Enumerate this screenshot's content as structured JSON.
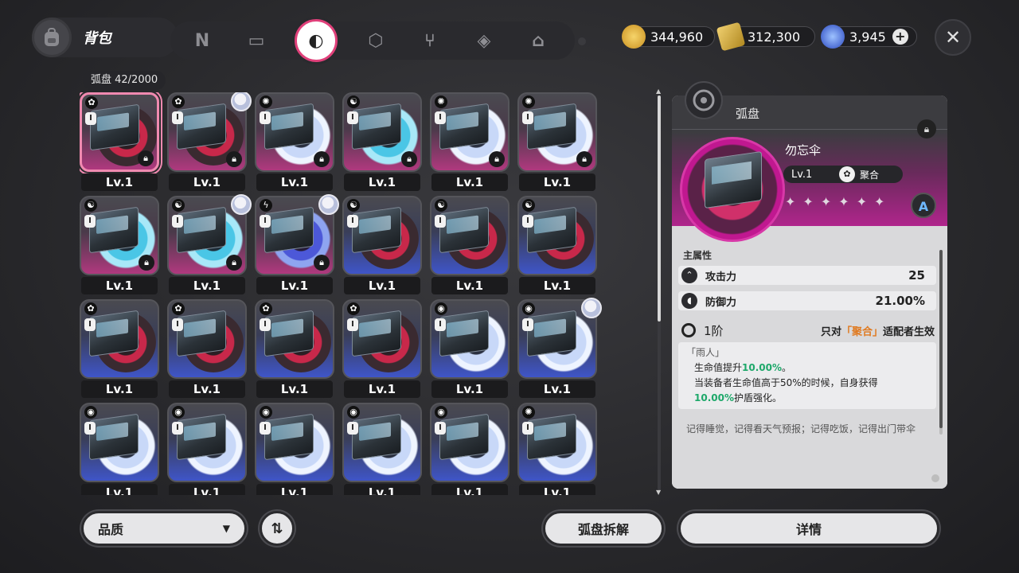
{
  "header": {
    "title": "背包",
    "categories": [
      {
        "name": "category-n-icon",
        "glyph": "N"
      },
      {
        "name": "category-console-icon",
        "glyph": "▭"
      },
      {
        "name": "category-disc-icon",
        "glyph": "◐",
        "active": true
      },
      {
        "name": "category-cube-icon",
        "glyph": "⬡"
      },
      {
        "name": "category-food-icon",
        "glyph": "⑂"
      },
      {
        "name": "category-gem-icon",
        "glyph": "◈"
      },
      {
        "name": "category-home-icon",
        "glyph": "⌂"
      }
    ],
    "currencies": [
      {
        "name": "gold-coin",
        "value": "344,960",
        "color": "#e8b83a"
      },
      {
        "name": "ticket",
        "value": "312,300",
        "color": "#d9b84a"
      },
      {
        "name": "crystal",
        "value": "3,945",
        "color": "#3a6ae8"
      }
    ],
    "add_label": "+",
    "close_label": "✕"
  },
  "inventory": {
    "count_label": "弧盘  42/2000",
    "items": [
      {
        "lv": "Lv.1",
        "bg": "pink",
        "disc": "d-red",
        "type": "✿",
        "rank": "I",
        "locked": true,
        "selected": true,
        "avatar": false
      },
      {
        "lv": "Lv.1",
        "bg": "pink",
        "disc": "d-red",
        "type": "✿",
        "rank": "I",
        "locked": true,
        "selected": false,
        "avatar": true
      },
      {
        "lv": "Lv.1",
        "bg": "pink",
        "disc": "d-white",
        "type": "✺",
        "rank": "I",
        "locked": true,
        "selected": false,
        "avatar": false
      },
      {
        "lv": "Lv.1",
        "bg": "pink",
        "disc": "d-cyan",
        "type": "☯",
        "rank": "I",
        "locked": true,
        "selected": false,
        "avatar": false
      },
      {
        "lv": "Lv.1",
        "bg": "pink",
        "disc": "d-white",
        "type": "✺",
        "rank": "I",
        "locked": true,
        "selected": false,
        "avatar": false
      },
      {
        "lv": "Lv.1",
        "bg": "pink",
        "disc": "d-white",
        "type": "✺",
        "rank": "I",
        "locked": true,
        "selected": false,
        "avatar": false
      },
      {
        "lv": "Lv.1",
        "bg": "pink",
        "disc": "d-cyan",
        "type": "☯",
        "rank": "I",
        "locked": true,
        "selected": false,
        "avatar": false
      },
      {
        "lv": "Lv.1",
        "bg": "pink",
        "disc": "d-cyan",
        "type": "☯",
        "rank": "I",
        "locked": true,
        "selected": false,
        "avatar": true
      },
      {
        "lv": "Lv.1",
        "bg": "pink",
        "disc": "d-purple",
        "type": "ϟ",
        "rank": "I",
        "locked": true,
        "selected": false,
        "avatar": true
      },
      {
        "lv": "Lv.1",
        "bg": "blue",
        "disc": "d-red",
        "type": "☯",
        "rank": "I",
        "locked": false,
        "selected": false,
        "avatar": false
      },
      {
        "lv": "Lv.1",
        "bg": "blue",
        "disc": "d-red",
        "type": "☯",
        "rank": "I",
        "locked": false,
        "selected": false,
        "avatar": false
      },
      {
        "lv": "Lv.1",
        "bg": "blue",
        "disc": "d-red",
        "type": "☯",
        "rank": "I",
        "locked": false,
        "selected": false,
        "avatar": false
      },
      {
        "lv": "Lv.1",
        "bg": "blue",
        "disc": "d-red",
        "type": "✿",
        "rank": "I",
        "locked": false,
        "selected": false,
        "avatar": false
      },
      {
        "lv": "Lv.1",
        "bg": "blue",
        "disc": "d-red",
        "type": "✿",
        "rank": "I",
        "locked": false,
        "selected": false,
        "avatar": false
      },
      {
        "lv": "Lv.1",
        "bg": "blue",
        "disc": "d-red",
        "type": "✿",
        "rank": "I",
        "locked": false,
        "selected": false,
        "avatar": false
      },
      {
        "lv": "Lv.1",
        "bg": "blue",
        "disc": "d-red",
        "type": "✿",
        "rank": "I",
        "locked": false,
        "selected": false,
        "avatar": false
      },
      {
        "lv": "Lv.1",
        "bg": "blue",
        "disc": "d-white",
        "type": "◉",
        "rank": "I",
        "locked": false,
        "selected": false,
        "avatar": false
      },
      {
        "lv": "Lv.1",
        "bg": "blue",
        "disc": "d-white",
        "type": "◉",
        "rank": "I",
        "locked": false,
        "selected": false,
        "avatar": true
      },
      {
        "lv": "Lv.1",
        "bg": "blue",
        "disc": "d-white",
        "type": "◉",
        "rank": "I",
        "locked": false,
        "selected": false,
        "avatar": false
      },
      {
        "lv": "Lv.1",
        "bg": "blue",
        "disc": "d-white",
        "type": "◉",
        "rank": "I",
        "locked": false,
        "selected": false,
        "avatar": false
      },
      {
        "lv": "Lv.1",
        "bg": "blue",
        "disc": "d-white",
        "type": "◉",
        "rank": "I",
        "locked": false,
        "selected": false,
        "avatar": false
      },
      {
        "lv": "Lv.1",
        "bg": "blue",
        "disc": "d-white",
        "type": "◉",
        "rank": "I",
        "locked": false,
        "selected": false,
        "avatar": false
      },
      {
        "lv": "Lv.1",
        "bg": "blue",
        "disc": "d-white",
        "type": "◉",
        "rank": "I",
        "locked": false,
        "selected": false,
        "avatar": false
      },
      {
        "lv": "Lv.1",
        "bg": "blue",
        "disc": "d-white",
        "type": "✺",
        "rank": "I",
        "locked": false,
        "selected": false,
        "avatar": false
      }
    ]
  },
  "detail": {
    "header_title": "弧盘",
    "disc_name": "勿忘伞",
    "level": "Lv.1",
    "set_name": "聚合",
    "stars": "✦✦✦✦✦✦",
    "rank_letter": "A",
    "section_label": "主属性",
    "stats": [
      {
        "name": "攻击力",
        "value": "25",
        "icon": "⌃"
      },
      {
        "name": "防御力",
        "value": "21.00%",
        "icon": "◖"
      }
    ],
    "tier": {
      "name": "1阶",
      "cond_prefix": "只对",
      "cond_highlight": "「聚合」",
      "cond_suffix": "适配者生效"
    },
    "effect": {
      "title": "「雨人」",
      "line1_a": "生命值提升",
      "line1_b": "10.00%",
      "line1_c": "。",
      "line2": "当装备者生命值高于50%的时候，自身获得",
      "line3_a": "10.00%",
      "line3_b": "护盾强化。"
    },
    "flavor": "记得睡觉，记得看天气预报；记得吃饭，记得出门带伞"
  },
  "footer": {
    "filter_label": "品质",
    "filter_caret": "▼",
    "sort_glyph": "⇅",
    "dismantle_label": "弧盘拆解",
    "detail_label": "详情"
  }
}
